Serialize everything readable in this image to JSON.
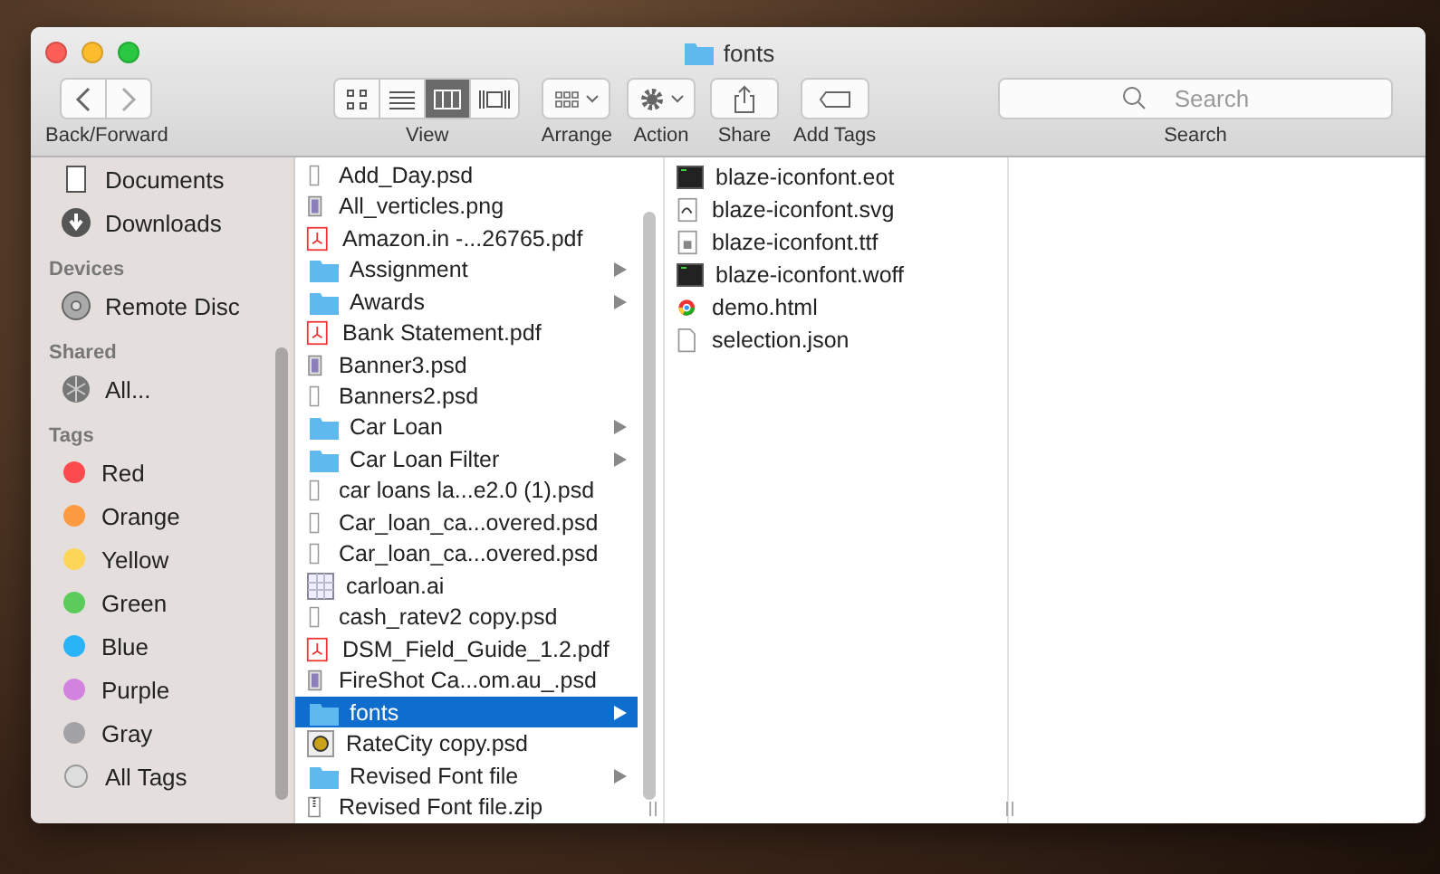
{
  "window": {
    "title": "fonts"
  },
  "toolbar": {
    "back_forward": {
      "label": "Back/Forward"
    },
    "view": {
      "label": "View",
      "modes": [
        {
          "kind": "icons",
          "selected": false
        },
        {
          "kind": "list",
          "selected": false
        },
        {
          "kind": "columns",
          "selected": true
        },
        {
          "kind": "coverflow",
          "selected": false
        }
      ]
    },
    "arrange": {
      "label": "Arrange"
    },
    "action": {
      "label": "Action"
    },
    "share": {
      "label": "Share"
    },
    "add_tags": {
      "label": "Add Tags"
    },
    "search": {
      "placeholder": "Search",
      "label": "Search"
    }
  },
  "sidebar": [
    {
      "items": [
        {
          "label": "Documents",
          "kind": "documents"
        },
        {
          "label": "Downloads",
          "kind": "downloads"
        }
      ]
    },
    {
      "header": "Devices",
      "items": [
        {
          "label": "Remote Disc",
          "kind": "disc"
        }
      ]
    },
    {
      "header": "Shared",
      "items": [
        {
          "label": "All...",
          "kind": "network"
        }
      ]
    },
    {
      "header": "Tags",
      "items": [
        {
          "label": "Red",
          "kind": "tag",
          "color": "#fc4a4e"
        },
        {
          "label": "Orange",
          "kind": "tag",
          "color": "#fd9b43"
        },
        {
          "label": "Yellow",
          "kind": "tag",
          "color": "#fcd559"
        },
        {
          "label": "Green",
          "kind": "tag",
          "color": "#5bcb5b"
        },
        {
          "label": "Blue",
          "kind": "tag",
          "color": "#2ab4f8"
        },
        {
          "label": "Purple",
          "kind": "tag",
          "color": "#d283e0"
        },
        {
          "label": "Gray",
          "kind": "tag",
          "color": "#a3a3a6"
        },
        {
          "label": "All Tags",
          "kind": "alltags"
        }
      ]
    }
  ],
  "columns": [
    {
      "items": [
        {
          "name": "Add_Day.psd",
          "kind": "blank",
          "selected": false
        },
        {
          "name": "All_verticles.png",
          "kind": "image",
          "selected": false
        },
        {
          "name": "Amazon.in -...26765.pdf",
          "kind": "pdf",
          "selected": false
        },
        {
          "name": "Assignment",
          "kind": "folder",
          "selected": false
        },
        {
          "name": "Awards",
          "kind": "folder",
          "selected": false
        },
        {
          "name": "Bank Statement.pdf",
          "kind": "pdf",
          "selected": false
        },
        {
          "name": "Banner3.psd",
          "kind": "image",
          "selected": false
        },
        {
          "name": "Banners2.psd",
          "kind": "blank",
          "selected": false
        },
        {
          "name": "Car Loan",
          "kind": "folder",
          "selected": false
        },
        {
          "name": "Car Loan Filter",
          "kind": "folder",
          "selected": false
        },
        {
          "name": "car loans la...e2.0 (1).psd",
          "kind": "blank",
          "selected": false
        },
        {
          "name": "Car_loan_ca...overed.psd",
          "kind": "blank",
          "selected": false
        },
        {
          "name": "Car_loan_ca...overed.psd",
          "kind": "blank",
          "selected": false
        },
        {
          "name": "carloan.ai",
          "kind": "ai",
          "selected": false
        },
        {
          "name": "cash_ratev2 copy.psd",
          "kind": "blank",
          "selected": false
        },
        {
          "name": "DSM_Field_Guide_1.2.pdf",
          "kind": "pdf",
          "selected": false
        },
        {
          "name": "FireShot Ca...om.au_.psd",
          "kind": "image",
          "selected": false
        },
        {
          "name": "fonts",
          "kind": "folder",
          "selected": true
        },
        {
          "name": "RateCity copy.psd",
          "kind": "badge",
          "selected": false
        },
        {
          "name": "Revised Font file",
          "kind": "folder",
          "selected": false
        },
        {
          "name": "Revised Font file.zip",
          "kind": "zip",
          "selected": false
        }
      ]
    },
    {
      "items": [
        {
          "name": "blaze-iconfont.eot",
          "kind": "terminal",
          "selected": false
        },
        {
          "name": "blaze-iconfont.svg",
          "kind": "vector",
          "selected": false
        },
        {
          "name": "blaze-iconfont.ttf",
          "kind": "font",
          "selected": false
        },
        {
          "name": "blaze-iconfont.woff",
          "kind": "terminal",
          "selected": false
        },
        {
          "name": "demo.html",
          "kind": "html",
          "selected": false
        },
        {
          "name": "selection.json",
          "kind": "doc",
          "selected": false
        }
      ]
    }
  ]
}
